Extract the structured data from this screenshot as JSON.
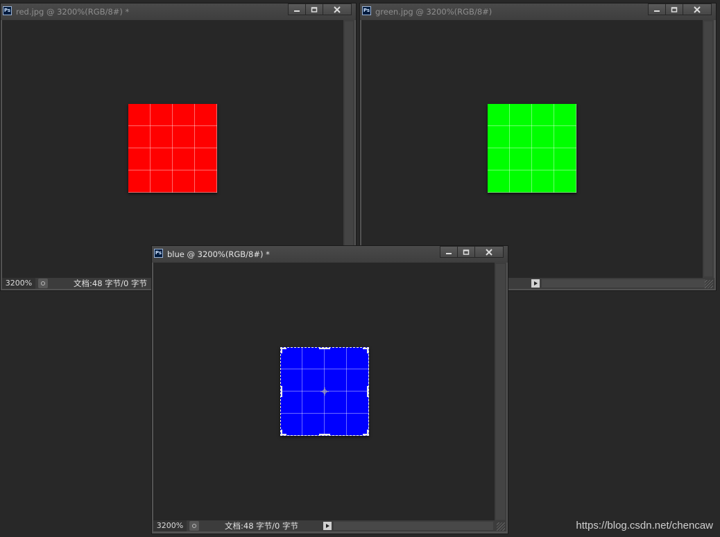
{
  "windows": {
    "red": {
      "title": "red.jpg @ 3200%(RGB/8#) *",
      "zoom": "3200%",
      "doc_info": "文档:48 字节/0 字节",
      "fill_color": "#ff0000",
      "state": "inactive"
    },
    "green": {
      "title": "green.jpg @ 3200%(RGB/8#)",
      "fill_color": "#00ff00",
      "state": "inactive"
    },
    "blue": {
      "title": "blue @ 3200%(RGB/8#) *",
      "zoom": "3200%",
      "doc_info": "文档:48 字节/0 字节",
      "fill_color": "#0000ff",
      "state": "active",
      "has_selection": true
    }
  },
  "app_icon_label": "Ps",
  "icons": {
    "app": "photoshop-icon",
    "minimize": "minimize-icon",
    "maximize": "maximize-icon",
    "close": "close-icon",
    "status_menu": "status-menu-arrow-icon",
    "preview": "preview-icon",
    "resize": "resize-grip-icon"
  },
  "colors": {
    "workspace_bg": "#282828",
    "canvas_bg": "#272727",
    "window_chrome": "#535353"
  },
  "watermark": "https://blog.csdn.net/chencaw"
}
